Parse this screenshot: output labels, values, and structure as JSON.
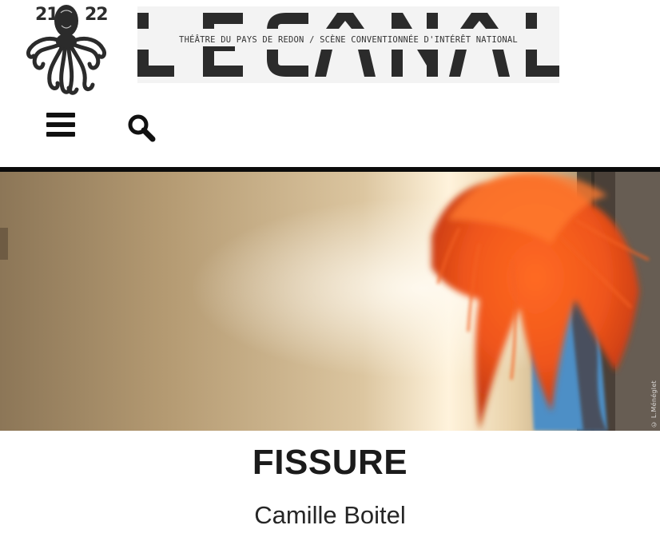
{
  "header": {
    "logo": {
      "year_left": "21",
      "year_right": "22",
      "wordmark": "LECANAL",
      "tagline": "THÉÂTRE DU PAYS DE REDON / SCÈNE CONVENTIONNÉE D'INTÉRÊT NATIONAL"
    },
    "nav": {
      "menu_icon": "hamburger-menu-icon",
      "search_icon": "search-icon"
    }
  },
  "hero": {
    "photo_credit": "© L.Ménéglet"
  },
  "event": {
    "title": "FISSURE",
    "artist": "Camille Boitel"
  },
  "colors": {
    "wordmark": "#2b2b2b",
    "hero_rule": "#0b0b0b",
    "title_text": "#1b1b1b",
    "hair_orange": "#f0561c",
    "jacket_blue": "#4e8fc6",
    "wall_beige": "#c9ad82"
  }
}
